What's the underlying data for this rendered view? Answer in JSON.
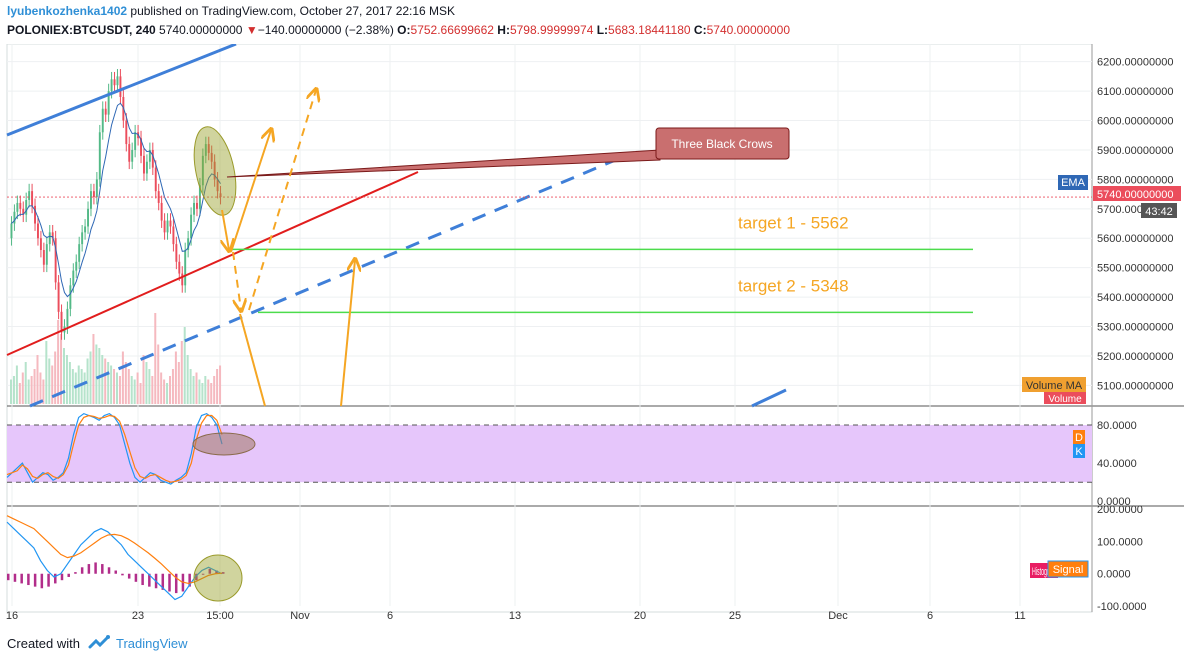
{
  "header": {
    "author": "lyubenkozhenka1402",
    "published": "published on TradingView.com, October 27, 2017 22:16 MSK",
    "symbol": "POLONIEX:BTCUSDT, 240",
    "last": "5740.00000000",
    "arrow": "▼",
    "change": "−140.00000000 (−2.38%)",
    "o_label": "O:",
    "o_value": "5752.66699662",
    "h_label": "H:",
    "h_value": "5798.99999974",
    "l_label": "L:",
    "l_value": "5683.18441180",
    "c_label": "C:",
    "c_value": "5740.00000000"
  },
  "footer": {
    "created": "Created with",
    "brand": "TradingView"
  },
  "colors": {
    "up": "#53b987",
    "down": "#eb4d5c",
    "ema": "#2f68b5",
    "orange": "#f5a623",
    "green": "#4cdc4c",
    "red_line": "#e11d1d",
    "blue_line": "#3f7fd8",
    "rsi_band": "#e6c6fb",
    "macd": "#2196f3",
    "signal": "#ff7f0e",
    "hist": "#b22d8a",
    "callout": "#c96f6f"
  },
  "chart_data": {
    "type": "candlestick",
    "main": {
      "ylim": [
        5030,
        6260
      ],
      "y_ticks": [
        "6200.00000000",
        "6100.00000000",
        "6000.00000000",
        "5900.00000000",
        "5800.00000000",
        "5700.00000000",
        "5600.00000000",
        "5500.00000000",
        "5400.00000000",
        "5300.00000000",
        "5200.00000000",
        "5100.00000000"
      ],
      "y_tick_values": [
        6200,
        6100,
        6000,
        5900,
        5800,
        5700,
        5600,
        5500,
        5400,
        5300,
        5200,
        5100
      ],
      "last_price_label": "5740.00000000",
      "last_price": 5740,
      "countdown": "43:42",
      "ema_label": "EMA",
      "volume_ma_label": "Volume MA",
      "volume_label": "Volume",
      "candles_close": [
        5650,
        5690,
        5720,
        5700,
        5680,
        5730,
        5760,
        5710,
        5650,
        5600,
        5560,
        5510,
        5580,
        5620,
        5600,
        5450,
        5350,
        5280,
        5300,
        5360,
        5440,
        5490,
        5520,
        5580,
        5620,
        5640,
        5700,
        5760,
        5740,
        5800,
        5960,
        6040,
        6020,
        6100,
        6140,
        6120,
        6150,
        6080,
        6000,
        5920,
        5860,
        5900,
        5960,
        5940,
        5880,
        5820,
        5860,
        5900,
        5840,
        5760,
        5720,
        5660,
        5620,
        5660,
        5640,
        5580,
        5520,
        5480,
        5440,
        5560,
        5600,
        5680,
        5720,
        5700,
        5780,
        5880,
        5920,
        5890,
        5860,
        5800,
        5760,
        5740
      ],
      "candles_open": [
        5600,
        5650,
        5690,
        5720,
        5700,
        5680,
        5730,
        5760,
        5710,
        5650,
        5600,
        5560,
        5510,
        5580,
        5620,
        5600,
        5450,
        5350,
        5280,
        5300,
        5360,
        5440,
        5490,
        5520,
        5580,
        5620,
        5640,
        5700,
        5760,
        5740,
        5800,
        5960,
        6040,
        6020,
        6100,
        6140,
        6120,
        6150,
        6080,
        6000,
        5920,
        5860,
        5900,
        5960,
        5940,
        5880,
        5820,
        5860,
        5900,
        5840,
        5760,
        5720,
        5660,
        5620,
        5660,
        5640,
        5580,
        5520,
        5480,
        5440,
        5560,
        5600,
        5680,
        5720,
        5700,
        5780,
        5880,
        5920,
        5890,
        5860,
        5800,
        5752.67
      ],
      "volumes": [
        70,
        80,
        110,
        60,
        90,
        120,
        70,
        80,
        100,
        140,
        90,
        70,
        180,
        130,
        110,
        150,
        240,
        200,
        160,
        140,
        120,
        100,
        90,
        110,
        100,
        90,
        130,
        150,
        200,
        170,
        160,
        140,
        130,
        120,
        110,
        100,
        90,
        80,
        150,
        120,
        100,
        80,
        70,
        90,
        60,
        140,
        120,
        100,
        80,
        260,
        170,
        90,
        70,
        60,
        80,
        100,
        150,
        120,
        180,
        220,
        140,
        100,
        80,
        90,
        70,
        60,
        80,
        70,
        60,
        80,
        100,
        110
      ],
      "annotations": {
        "callout": "Three Black Crows",
        "target1": "target 1 - 5562",
        "target2": "target 2 - 5348",
        "target1_value": 5562,
        "target2_value": 5348
      }
    },
    "stoch": {
      "ylim": [
        -5,
        100
      ],
      "y_ticks": [
        "80.0000",
        "40.0000",
        "0.0000"
      ],
      "y_tick_values": [
        80,
        40,
        0
      ],
      "band": [
        20,
        80
      ],
      "labels": [
        "D",
        "K"
      ],
      "k": [
        25,
        30,
        35,
        40,
        30,
        20,
        25,
        30,
        28,
        22,
        25,
        30,
        45,
        70,
        88,
        92,
        90,
        88,
        85,
        90,
        92,
        88,
        80,
        60,
        40,
        25,
        20,
        25,
        30,
        28,
        22,
        20,
        18,
        22,
        25,
        30,
        50,
        78,
        90,
        92,
        88,
        80,
        60
      ],
      "d": [
        28,
        30,
        32,
        38,
        34,
        26,
        24,
        28,
        30,
        26,
        24,
        28,
        38,
        60,
        80,
        88,
        90,
        89,
        87,
        88,
        90,
        89,
        84,
        70,
        52,
        35,
        26,
        24,
        27,
        28,
        25,
        22,
        20,
        21,
        23,
        27,
        40,
        65,
        82,
        90,
        90,
        85,
        70
      ]
    },
    "macd": {
      "ylim": [
        -100,
        210
      ],
      "y_ticks": [
        "200.0000",
        "100.0000",
        "0.0000",
        "-100.0000"
      ],
      "y_tick_values": [
        200,
        100,
        0,
        -100
      ],
      "labels": [
        "Histogram",
        "Signal"
      ],
      "macd": [
        160,
        140,
        120,
        100,
        80,
        40,
        10,
        -10,
        0,
        30,
        60,
        90,
        110,
        130,
        140,
        130,
        110,
        90,
        60,
        40,
        20,
        0,
        -20,
        -40,
        -60,
        -80,
        -70,
        -40,
        -10,
        10,
        20,
        10,
        0
      ],
      "signal": [
        180,
        170,
        160,
        150,
        140,
        120,
        100,
        80,
        60,
        50,
        55,
        65,
        80,
        95,
        110,
        120,
        122,
        118,
        108,
        95,
        80,
        65,
        48,
        30,
        10,
        -10,
        -25,
        -30,
        -25,
        -15,
        -5,
        0,
        2
      ],
      "hist": [
        -20,
        -25,
        -30,
        -35,
        -40,
        -45,
        -40,
        -30,
        -20,
        -10,
        5,
        20,
        30,
        35,
        30,
        20,
        10,
        -5,
        -15,
        -25,
        -35,
        -40,
        -45,
        -50,
        -55,
        -60,
        -55,
        -40,
        -20,
        0,
        15,
        10,
        5
      ]
    },
    "x_ticks": [
      "16",
      "23",
      "15:00",
      "Nov",
      "6",
      "13",
      "20",
      "25",
      "Dec",
      "6",
      "11"
    ]
  }
}
